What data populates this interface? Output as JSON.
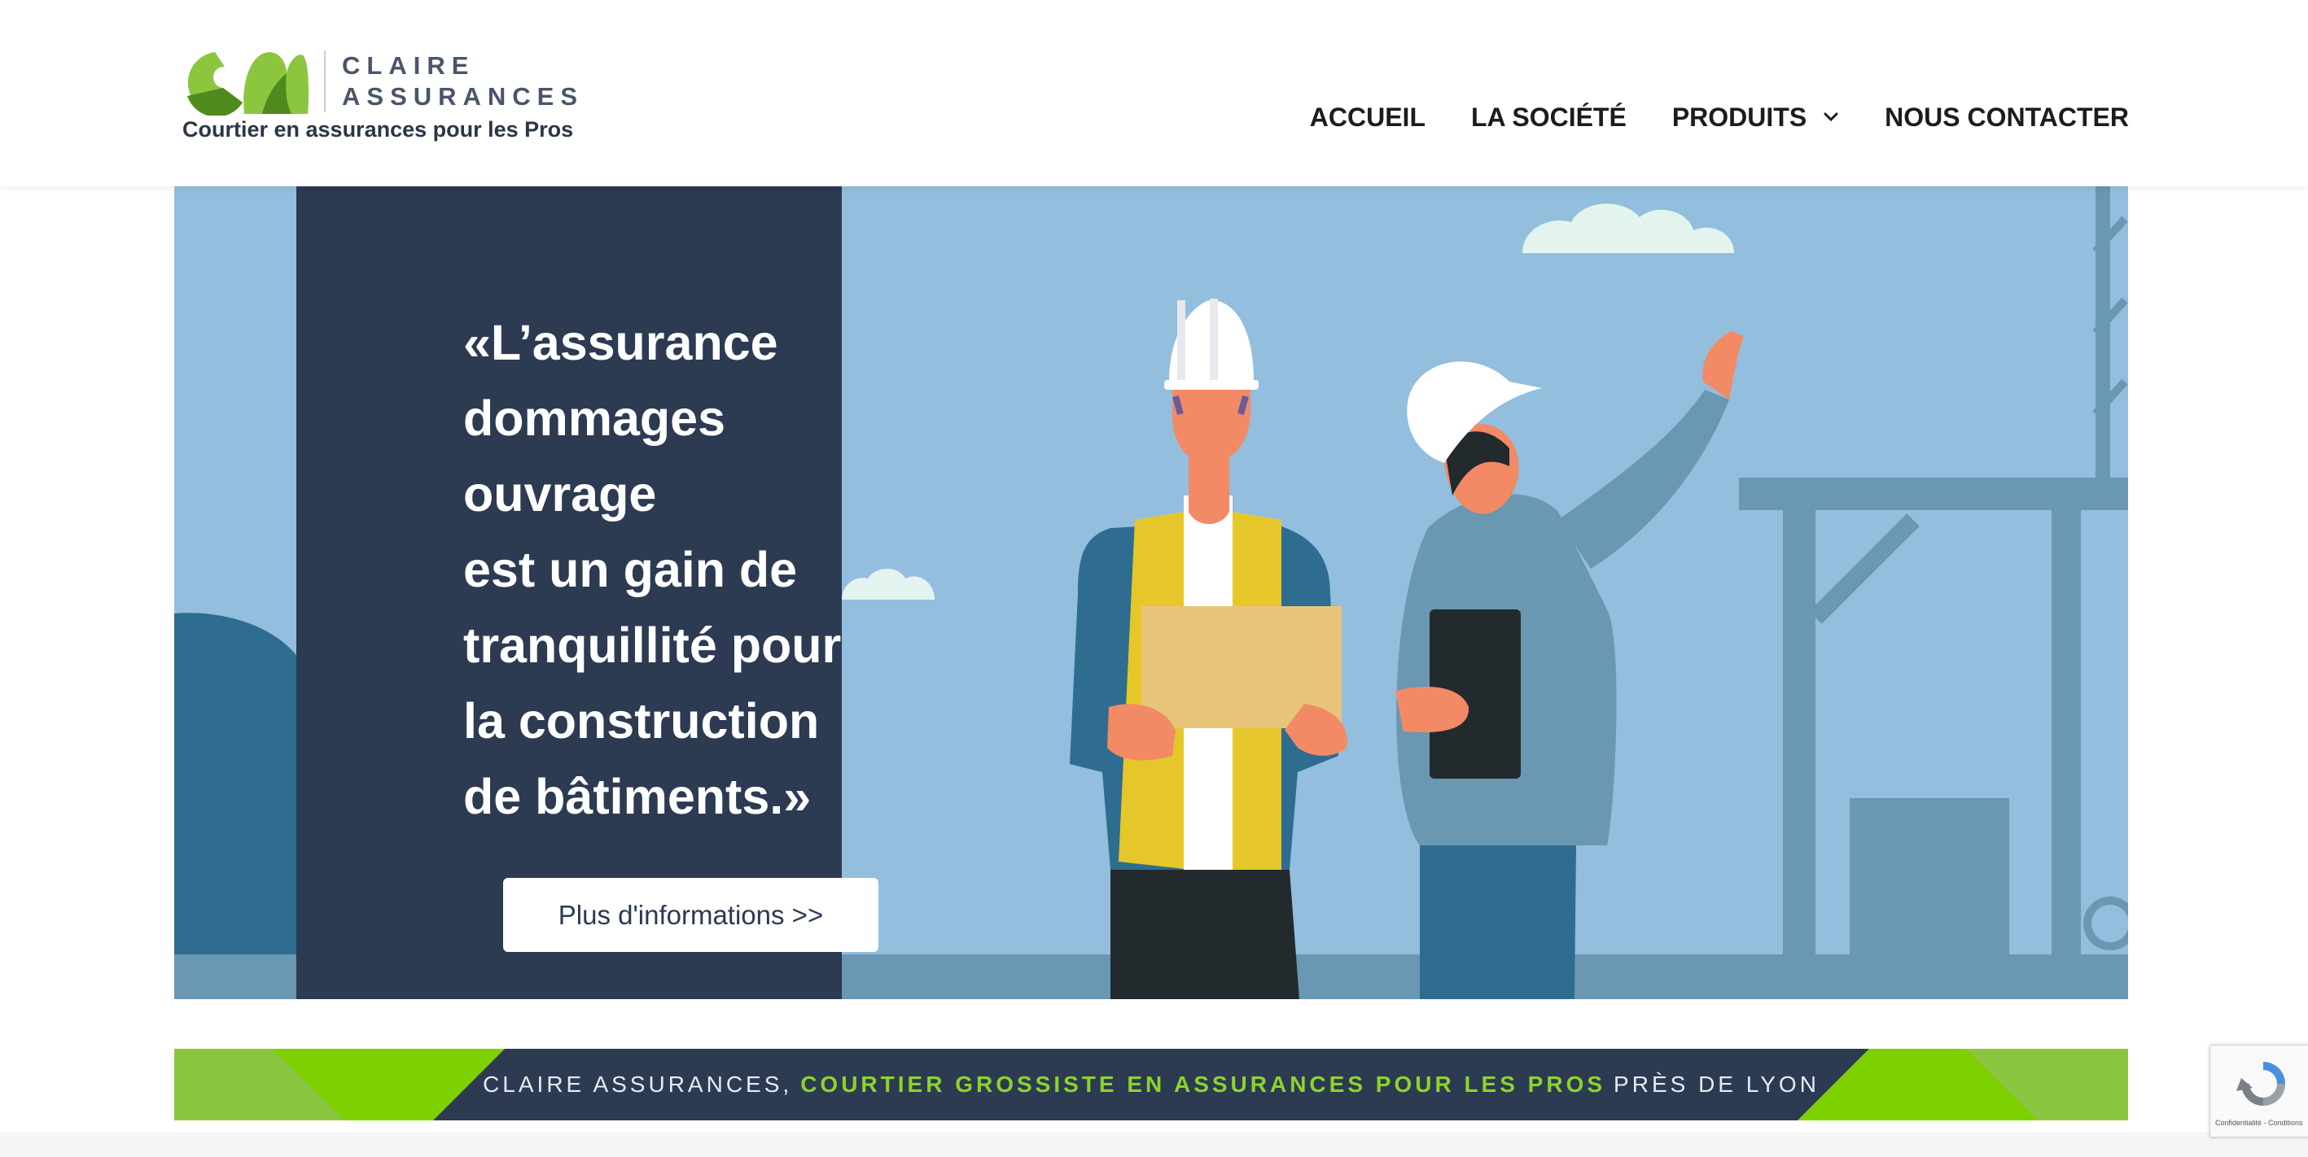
{
  "brand": {
    "name_line1": "CLAIRE",
    "name_line2": "ASSURANCES",
    "tagline": "Courtier en assurances pour les Pros",
    "colors": {
      "green_light": "#8cc63f",
      "green_dark": "#4f8a1e",
      "navy": "#2c3a52"
    }
  },
  "nav": {
    "items": [
      {
        "label": "ACCUEIL"
      },
      {
        "label": "LA SOCIÉTÉ"
      },
      {
        "label": "PRODUITS",
        "has_dropdown": true
      },
      {
        "label": "NOUS CONTACTER"
      }
    ]
  },
  "hero": {
    "quote_lines": [
      "«L’assurance",
      "dommages",
      "ouvrage",
      "est un gain de",
      "tranquillité pour",
      "la construction",
      "de bâtiments.»"
    ],
    "button_label": "Plus d'informations >>"
  },
  "banner": {
    "prefix": "CLAIRE ASSURANCES,",
    "highlight": "COURTIER GROSSISTE EN ASSURANCES POUR LES PROS",
    "suffix": "PRÈS DE LYON",
    "accent_color": "#8cd42a"
  },
  "recaptcha": {
    "text": "Confidentialité - Conditions"
  }
}
